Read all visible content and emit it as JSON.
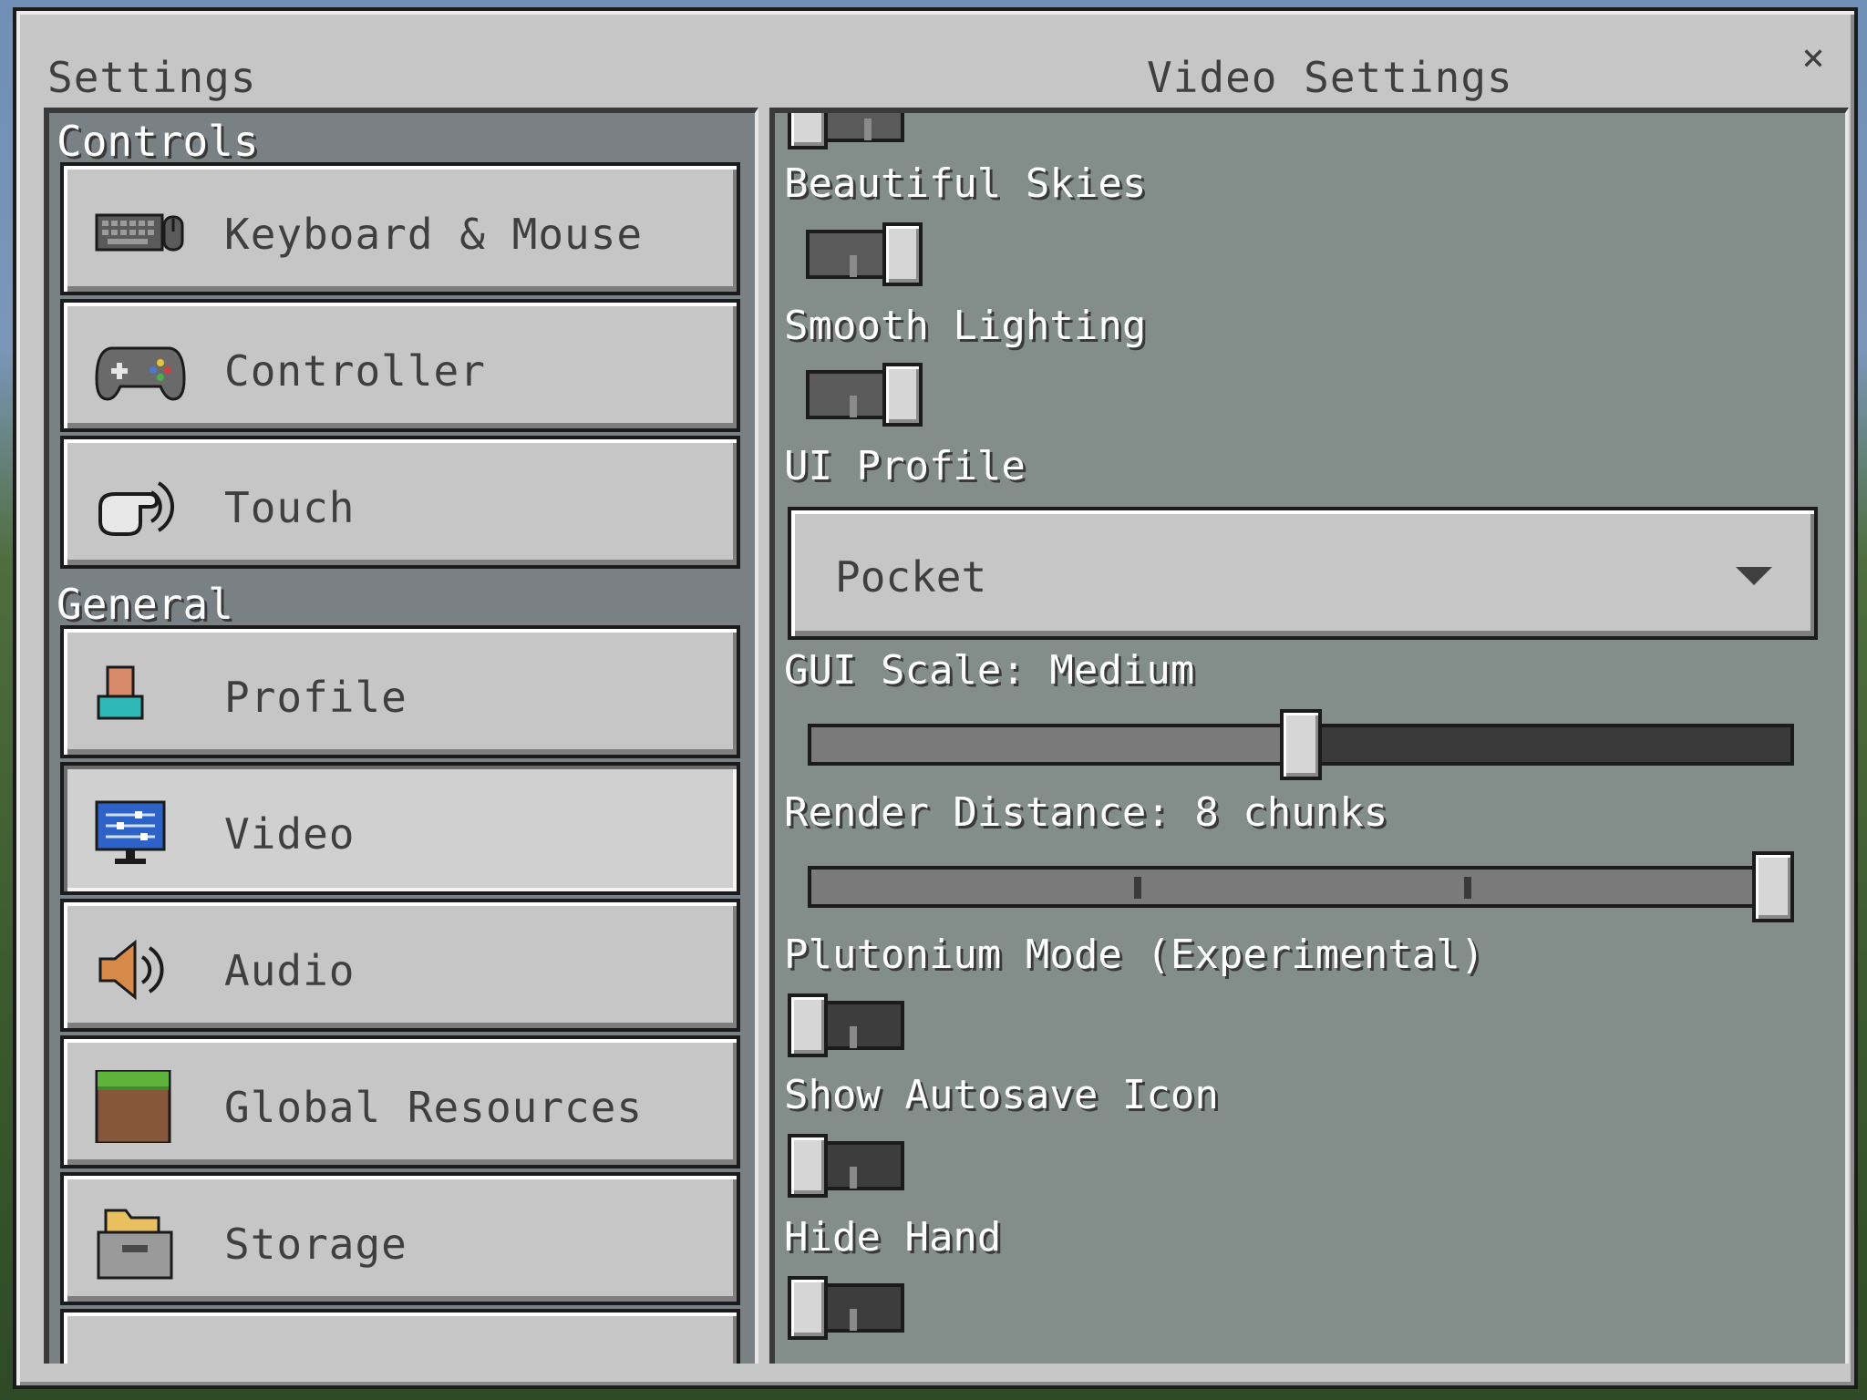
{
  "window": {
    "left_title": "Settings",
    "right_title": "Video Settings",
    "close_glyph": "×"
  },
  "nav": {
    "sections": [
      {
        "header": "Controls",
        "items": [
          {
            "label": "Keyboard & Mouse",
            "icon": "keyboard-mouse-icon"
          },
          {
            "label": "Controller",
            "icon": "gamepad-icon"
          },
          {
            "label": "Touch",
            "icon": "touch-icon"
          }
        ]
      },
      {
        "header": "General",
        "items": [
          {
            "label": "Profile",
            "icon": "profile-icon"
          },
          {
            "label": "Video",
            "icon": "monitor-icon",
            "selected": true
          },
          {
            "label": "Audio",
            "icon": "speaker-icon"
          },
          {
            "label": "Global Resources",
            "icon": "grass-block-icon"
          },
          {
            "label": "Storage",
            "icon": "storage-icon"
          }
        ]
      }
    ]
  },
  "video": {
    "beautiful_skies": {
      "label": "Beautiful Skies",
      "on": true
    },
    "smooth_lighting": {
      "label": "Smooth Lighting",
      "on": true
    },
    "ui_profile": {
      "label": "UI Profile",
      "value": "Pocket"
    },
    "gui_scale": {
      "label": "GUI Scale: Medium",
      "position": 0.5
    },
    "render_distance": {
      "label": "Render Distance: 8 chunks",
      "position": 1.0
    },
    "plutonium_mode": {
      "label": "Plutonium Mode (Experimental)",
      "on": false
    },
    "show_autosave_icon": {
      "label": "Show Autosave Icon",
      "on": false
    },
    "hide_hand": {
      "label": "Hide Hand",
      "on": false
    }
  },
  "colors": {
    "panel_gray": "#c6c6c6",
    "border_dark": "#1b1b1b",
    "text_dark": "#3f3f3f",
    "text_light": "#ffffff"
  }
}
